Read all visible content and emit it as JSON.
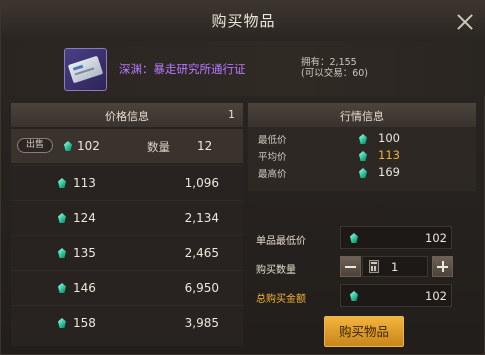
{
  "window": {
    "title": "购买物品"
  },
  "item": {
    "name": "深渊：暴走研究所通行证",
    "owned_line": "拥有：2,155",
    "tradable_line": "(可以交易：60)"
  },
  "price_panel": {
    "title": "价格信息",
    "count": "1",
    "sell_badge": "出售",
    "sell_price": "102",
    "qty_label": "数量",
    "sell_qty": "12",
    "rows": [
      {
        "price": "113",
        "qty": "1,096"
      },
      {
        "price": "124",
        "qty": "2,134"
      },
      {
        "price": "135",
        "qty": "2,465"
      },
      {
        "price": "146",
        "qty": "6,950"
      },
      {
        "price": "158",
        "qty": "3,985"
      }
    ]
  },
  "market": {
    "title": "行情信息",
    "lowest_label": "最低价",
    "lowest": "100",
    "average_label": "平均价",
    "average": "113",
    "highest_label": "最高价",
    "highest": "169"
  },
  "form": {
    "unit_min_label": "单品最低价",
    "unit_min_value": "102",
    "qty_label": "购买数量",
    "qty_value": "1",
    "total_label": "总购买金额",
    "total_value": "102"
  },
  "buy_button": "购买物品",
  "colors": {
    "accent_gold": "#f0b23a",
    "item_purple": "#b678ff",
    "currency_gem": "#2bc59d"
  },
  "icons": [
    "close-icon",
    "gem-icon",
    "calculator-icon",
    "minus-icon",
    "plus-icon"
  ]
}
